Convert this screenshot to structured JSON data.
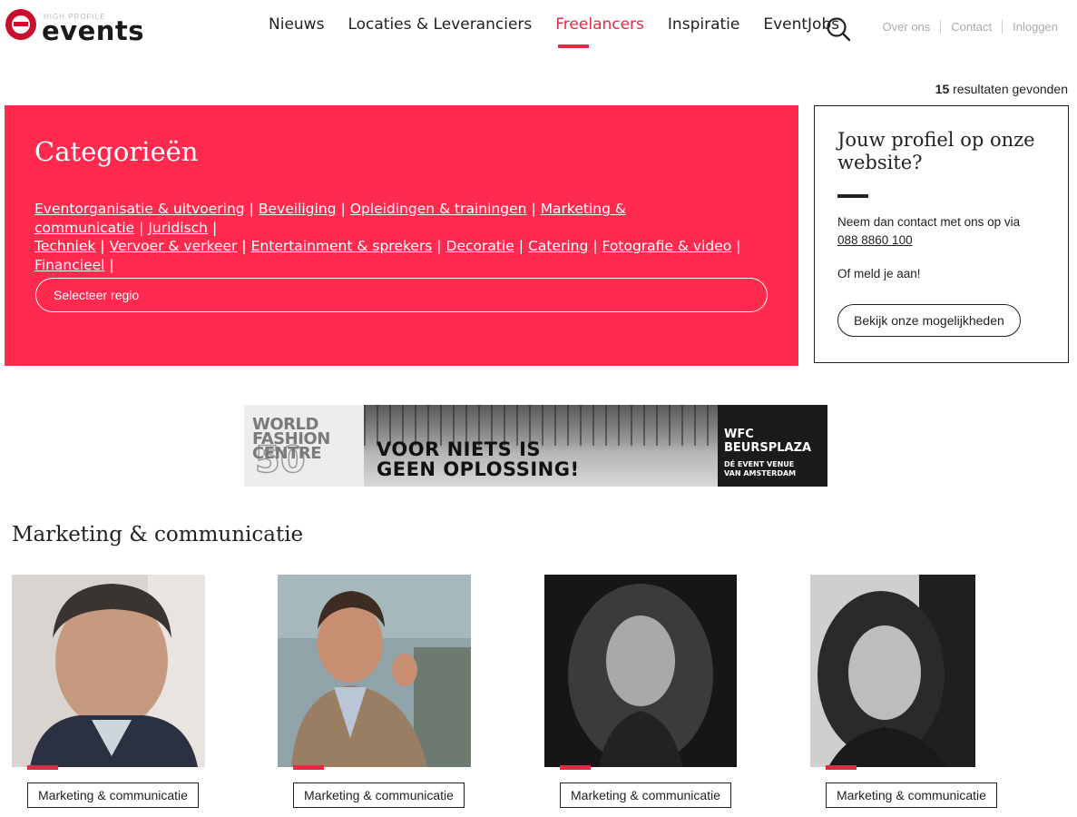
{
  "header": {
    "logo_small": "HIGH PROFILE",
    "logo_text": "events",
    "nav": [
      {
        "label": "Nieuws"
      },
      {
        "label": "Locaties & Leveranciers"
      },
      {
        "label": "Freelancers",
        "active": true
      },
      {
        "label": "Inspiratie"
      },
      {
        "label": "EventJobs"
      }
    ],
    "utility": [
      {
        "label": "Over ons"
      },
      {
        "label": "Contact"
      },
      {
        "label": "Inloggen"
      }
    ]
  },
  "results": {
    "count": "15",
    "label": "resultaten gevonden"
  },
  "categories": {
    "title": "Categorieën",
    "links": [
      "Eventorganisatie & uitvoering",
      "Beveiliging",
      "Opleidingen & trainingen",
      "Marketing & communicatie",
      "Juridisch",
      "Techniek",
      "Vervoer & verkeer",
      "Entertainment & sprekers",
      "Decoratie",
      "Catering",
      "Fotografie & video",
      "Financieel"
    ],
    "region_placeholder": "Selecteer regio"
  },
  "profile": {
    "title": "Jouw profiel op onze website?",
    "contact_text": "Neem dan contact met ons op via",
    "phone": "088 8860 100",
    "signup_text": "Of meld je aan!",
    "button": "Bekijk onze mogelijkheden"
  },
  "banner": {
    "logo_line1": "WORLD",
    "logo_line2": "FASHION",
    "logo_line3": "CENTRE",
    "logo_number": "50",
    "slogan_line1": "VOOR NIETS IS",
    "slogan_line2": "GEEN OPLOSSING!",
    "brand_line1": "WFC",
    "brand_line2": "BEURSPLAZA",
    "tagline_line1": "DÉ EVENT VENUE",
    "tagline_line2": "VAN AMSTERDAM"
  },
  "section": {
    "title": "Marketing & communicatie",
    "cards": [
      {
        "tag": "Marketing & communicatie"
      },
      {
        "tag": "Marketing & communicatie"
      },
      {
        "tag": "Marketing & communicatie"
      },
      {
        "tag": "Marketing & communicatie"
      }
    ]
  },
  "colors": {
    "brand_red": "#ee2545",
    "panel_red": "#ff2a4d",
    "logo_red": "#c8102e"
  }
}
